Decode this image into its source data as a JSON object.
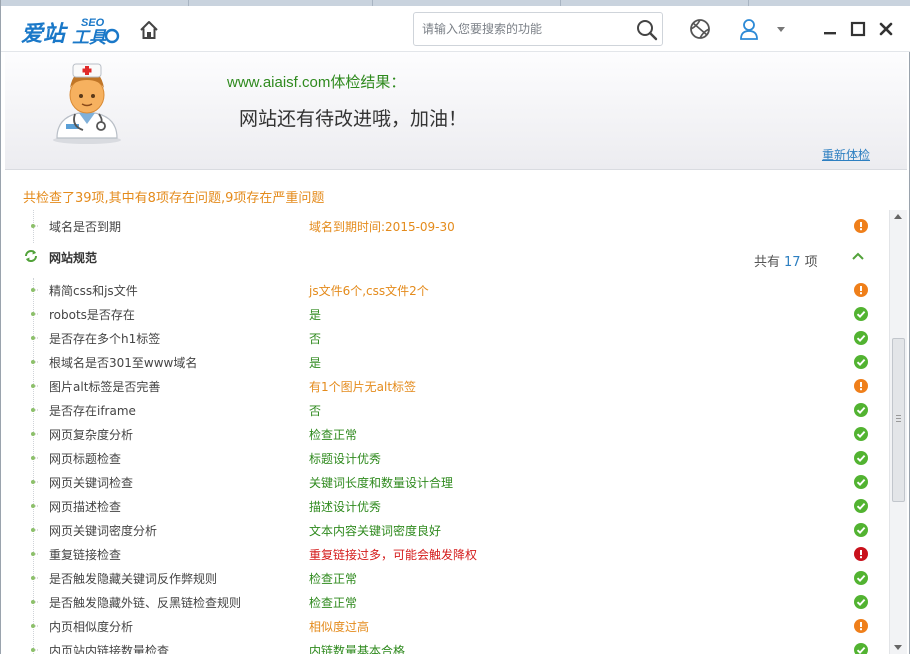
{
  "app": {
    "logo_text": "爱站SEO工具包",
    "search_placeholder": "请输入您要搜索的功能"
  },
  "header": {
    "site_result": "www.aiaisf.com体检结果：",
    "verdict": "网站还有待改进哦，加油！",
    "recheck": "重新体检"
  },
  "summary": "共检查了39项,其中有8项存在问题,9项存在严重问题",
  "first_item": {
    "name": "域名是否到期",
    "result": "域名到期时间:2015-09-30",
    "status": "warn"
  },
  "section": {
    "title": "网站规范",
    "count_prefix": "共有",
    "count": "17",
    "count_suffix": "项"
  },
  "items": [
    {
      "name": "精简css和js文件",
      "result": "js文件6个,css文件2个",
      "color": "orange",
      "status": "warn"
    },
    {
      "name": "robots是否存在",
      "result": "是",
      "color": "green",
      "status": "ok"
    },
    {
      "name": "是否存在多个h1标签",
      "result": "否",
      "color": "green",
      "status": "ok"
    },
    {
      "name": "根域名是否301至www域名",
      "result": "是",
      "color": "green",
      "status": "ok"
    },
    {
      "name": "图片alt标签是否完善",
      "result": "有1个图片无alt标签",
      "color": "orange",
      "status": "warn"
    },
    {
      "name": "是否存在iframe",
      "result": "否",
      "color": "green",
      "status": "ok"
    },
    {
      "name": "网页复杂度分析",
      "result": "检查正常",
      "color": "green",
      "status": "ok"
    },
    {
      "name": "网页标题检查",
      "result": "标题设计优秀",
      "color": "green",
      "status": "ok"
    },
    {
      "name": "网页关键词检查",
      "result": "关键词长度和数量设计合理",
      "color": "green",
      "status": "ok"
    },
    {
      "name": "网页描述检查",
      "result": "描述设计优秀",
      "color": "green",
      "status": "ok"
    },
    {
      "name": "网页关键词密度分析",
      "result": "文本内容关键词密度良好",
      "color": "green",
      "status": "ok"
    },
    {
      "name": "重复链接检查",
      "result": "重复链接过多，可能会触发降权",
      "color": "red",
      "status": "err"
    },
    {
      "name": "是否触发隐藏关键词反作弊规则",
      "result": "检查正常",
      "color": "green",
      "status": "ok"
    },
    {
      "name": "是否触发隐藏外链、反黑链检查规则",
      "result": "检查正常",
      "color": "green",
      "status": "ok"
    },
    {
      "name": "内页相似度分析",
      "result": "相似度过高",
      "color": "orange",
      "status": "warn"
    },
    {
      "name": "内页站内链接数量检查",
      "result": "内链数量基本合格",
      "color": "green",
      "status": "ok"
    }
  ],
  "colors": {
    "green": "#2f8a1e",
    "orange": "#e48b1c",
    "red": "#d41c1c",
    "link": "#2d7fc1"
  }
}
